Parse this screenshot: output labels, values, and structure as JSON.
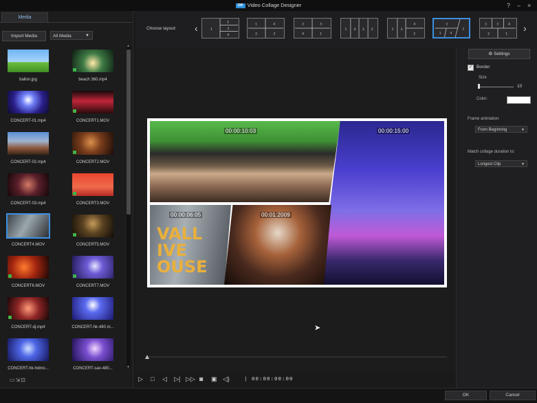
{
  "window": {
    "title": "Video Collage Designer",
    "logo_text": "DR",
    "help_label": "?",
    "minimize_label": "–",
    "close_label": "×"
  },
  "media_panel": {
    "tab_label": "Media",
    "import_label": "Import Media",
    "filter_value": "All Media",
    "items": [
      {
        "label": "ballon.jpg",
        "bg": "linear-gradient(#6fb3f0 0%, #a8d6ff 55%, #6cbf3a 56%, #3f8f25 100%)",
        "badge": false,
        "selected": false
      },
      {
        "label": "beach 360.mp4",
        "bg": "radial-gradient(circle at 50% 60%, #ffe9a8 0%, #3e7a44 40%, #0d1c12 100%)",
        "badge": true,
        "selected": false
      },
      {
        "label": "CONCERT-01.mp4",
        "bg": "radial-gradient(circle at 50% 40%, #ffffff 0%, #6f7ff7 25%, #2a1f8a 60%, #0d0b2e 100%)",
        "badge": false,
        "selected": false
      },
      {
        "label": "CONCERT1.MOV",
        "bg": "linear-gradient(#1a0a0a 0%, #c0263a 45%, #2a0b0b 100%)",
        "badge": true,
        "selected": false
      },
      {
        "label": "CONCERT-02.mp4",
        "bg": "linear-gradient(#5a8fd8 0%, #9fb4cf 40%, #8d5a3e 70%, #3a2416 100%)",
        "badge": false,
        "selected": false
      },
      {
        "label": "CONCERT2.MOV",
        "bg": "radial-gradient(circle at 45% 45%, #d98f4a 0%, #7a3d1c 40%, #1b0d08 100%)",
        "badge": true,
        "selected": false
      },
      {
        "label": "CONCERT-03.mp4",
        "bg": "radial-gradient(circle at 50% 50%, #d37a66 0%, #5a1f2a 45%, #160709 100%)",
        "badge": false,
        "selected": false
      },
      {
        "label": "CONCERT3.MOV",
        "bg": "linear-gradient(#e9452e 0%, #f06a4b 60%, #b32a20 100%)",
        "badge": true,
        "selected": false
      },
      {
        "label": "CONCERT4.MOV",
        "bg": "linear-gradient(120deg, #3c4248 0%, #9aa7ad 45%, #2c3035 100%)",
        "badge": false,
        "selected": true
      },
      {
        "label": "CONCERT5.MOV",
        "bg": "radial-gradient(circle at 50% 40%, #c59b5a 0%, #5b4322 40%, #120c06 100%)",
        "badge": true,
        "selected": false
      },
      {
        "label": "CONCERT6.MOV",
        "bg": "radial-gradient(circle at 40% 50%, #ff7a2e 0%, #a3250f 45%, #1c0804 100%)",
        "badge": true,
        "selected": false
      },
      {
        "label": "CONCERT7.MOV",
        "bg": "radial-gradient(circle at 55% 45%, #e6e6ff 0%, #6d5cd6 30%, #1e1650 100%)",
        "badge": true,
        "selected": false
      },
      {
        "label": "CONCERT-dj.mp4",
        "bg": "radial-gradient(circle at 50% 50%, #ff9b7a 0%, #8f2626 45%, #1a0606 100%)",
        "badge": true,
        "selected": false
      },
      {
        "label": "CONCERT-hk-480.m...",
        "bg": "radial-gradient(circle at 50% 35%, #ffffff 0%, #5b6bf0 30%, #1b1870 100%)",
        "badge": false,
        "selected": false
      },
      {
        "label": "CONCERT-hk-hdmo...",
        "bg": "radial-gradient(circle at 50% 45%, #cfe0ff 0%, #4d66e6 35%, #15165a 100%)",
        "badge": false,
        "selected": false
      },
      {
        "label": "CONCERT-sax-480...",
        "bg": "radial-gradient(circle at 55% 45%, #f2d6ff 0%, #7a4fd0 35%, #1d1050 100%)",
        "badge": false,
        "selected": false
      }
    ],
    "bottom_icons": "▭⇲⊡"
  },
  "layouts": {
    "choose_label": "Choose layout:",
    "prev_label": "‹",
    "next_label": "›",
    "items": [
      {
        "id": "L1",
        "selected": false
      },
      {
        "id": "L2",
        "selected": false
      },
      {
        "id": "L3",
        "selected": false
      },
      {
        "id": "L4",
        "selected": false
      },
      {
        "id": "L5",
        "selected": false
      },
      {
        "id": "L6",
        "selected": true
      },
      {
        "id": "L7",
        "selected": false
      }
    ]
  },
  "collage": {
    "cells": [
      {
        "time": "00:00:10:03",
        "bg": "linear-gradient(#58b94a 0%, #3f8f35 25%, #2a2a2a 40%, #6b5a46 55%, #c9a98a 65%, #8e6b54 80%, #3b2b22 100%)"
      },
      {
        "time": "00:00:15:00",
        "bg": "linear-gradient(#2b2890 0%, #4a3fcf 30%, #7f6ee6 55%, #c05ad6 70%, #3a2a6e 85%, #120f30 100%)"
      },
      {
        "time": "00:00:06:05",
        "bg": "linear-gradient(100deg, #6a7077 0%, #a8b0b6 40%, #4a4f55 100%)"
      },
      {
        "time": "00:01:2009",
        "bg": "radial-gradient(circle at 50% 35%, #e6d8c8 0%, #a6623a 30%, #4a2a1e 60%, #140b08 100%)"
      }
    ]
  },
  "cell_labels": {
    "c3_text": "VALL IVE OUSE"
  },
  "transport": {
    "play": "▷",
    "stop": "□",
    "prev": "◁",
    "next_frame": "▷|",
    "fast": "▷▷",
    "snapshot": "◙",
    "fullscreen": "▣",
    "volume": "◁)",
    "timecode": "| 00:00:00:00"
  },
  "settings": {
    "button_label": "Settings",
    "button_icon": "⚙",
    "border_label": "Border",
    "border_checked": "✓",
    "size_label": "Size",
    "size_value": "10",
    "color_label": "Color:",
    "border_color": "#ffffff",
    "frame_animation_label": "Frame animation:",
    "frame_animation_value": "From Beginning",
    "match_duration_label": "Match collage duration to:",
    "match_duration_value": "Longest Clip"
  },
  "footer": {
    "ok_label": "OK",
    "cancel_label": "Cancel"
  }
}
